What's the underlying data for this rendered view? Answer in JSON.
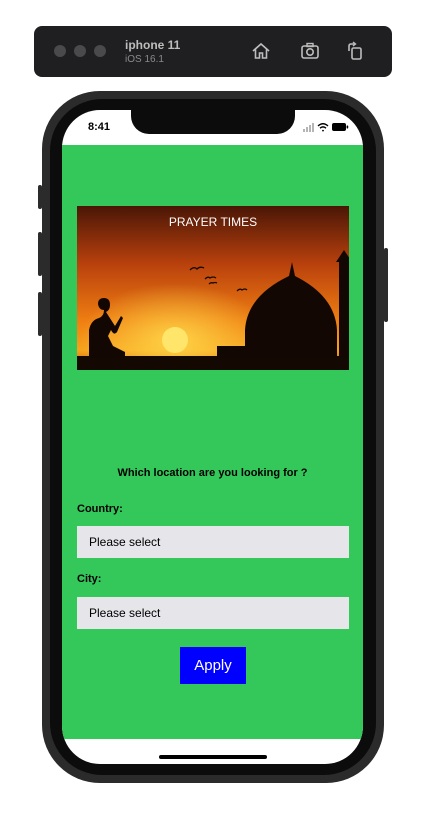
{
  "simulator": {
    "device_name": "iphone 11",
    "os_version": "iOS 16.1",
    "icons": [
      "home-icon",
      "screenshot-icon",
      "rotate-icon"
    ]
  },
  "status_bar": {
    "time": "8:41",
    "icons": [
      "signal-icon",
      "wifi-icon",
      "battery-icon"
    ]
  },
  "app": {
    "background_color": "#34c759",
    "hero": {
      "title": "PRAYER TIMES"
    },
    "question": "Which location are you looking for ?",
    "country": {
      "label": "Country:",
      "value": "Please select"
    },
    "city": {
      "label": "City:",
      "value": "Please select"
    },
    "apply_label": "Apply",
    "apply_color": "#0000ff"
  }
}
